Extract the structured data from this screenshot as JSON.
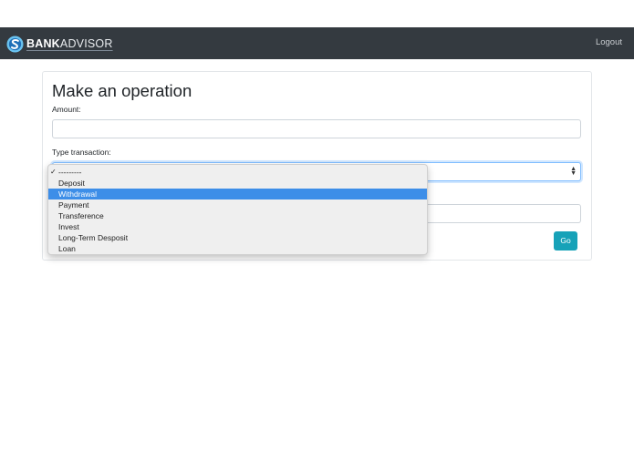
{
  "navbar": {
    "brand_bold": "BANK",
    "brand_light": "ADVISOR",
    "logout_label": "Logout"
  },
  "form": {
    "title": "Make an operation",
    "amount_label": "Amount:",
    "amount_value": "",
    "type_label": "Type transaction:",
    "go_label": "Go"
  },
  "dropdown": {
    "check_mark": "✓",
    "options": [
      "---------",
      "Deposit",
      "Withdrawal",
      "Payment",
      "Transference",
      "Invest",
      "Long-Term Desposit",
      "Loan"
    ],
    "highlighted_option": "Withdrawal"
  },
  "colors": {
    "navbar_bg": "#343a40",
    "accent_button": "#17a2b8",
    "highlight": "#3d8ee8"
  }
}
